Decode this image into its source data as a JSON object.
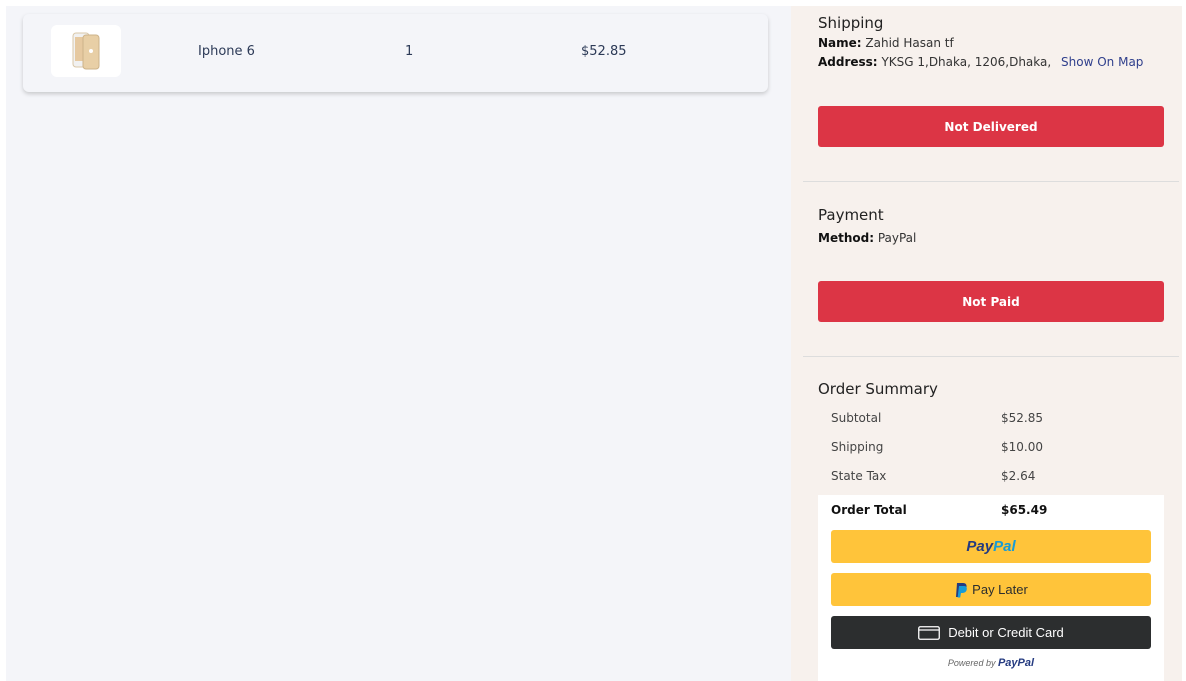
{
  "order_item": {
    "image_alt": "phone-thumbnail",
    "name": "Iphone 6",
    "quantity": "1",
    "price": "$52.85"
  },
  "shipping": {
    "title": "Shipping",
    "name_label": "Name:",
    "name_value": "Zahid Hasan tf",
    "address_label": "Address:",
    "address_value": "YKSG 1,Dhaka, 1206,Dhaka,",
    "map_link": "Show On Map",
    "status": "Not Delivered"
  },
  "payment": {
    "title": "Payment",
    "method_label": "Method:",
    "method_value": "PayPal",
    "status": "Not Paid"
  },
  "summary": {
    "title": "Order Summary",
    "rows": [
      {
        "label": "Subtotal",
        "value": "$52.85"
      },
      {
        "label": "Shipping",
        "value": "$10.00"
      },
      {
        "label": "State Tax",
        "value": "$2.64"
      }
    ],
    "total_label": "Order Total",
    "total_value": "$65.49"
  },
  "paypal": {
    "logo_part1": "Pay",
    "logo_part2": "Pal",
    "pay_later": "Pay Later",
    "card_button": "Debit or Credit Card",
    "powered_by": "Powered by",
    "powered_logo": "PayPal"
  },
  "colors": {
    "danger": "#dc3545",
    "paypal_gold": "#ffc43a",
    "paypal_dark_blue": "#253b80",
    "paypal_light_blue": "#179bd7",
    "card_button_bg": "#2c2e2f"
  }
}
